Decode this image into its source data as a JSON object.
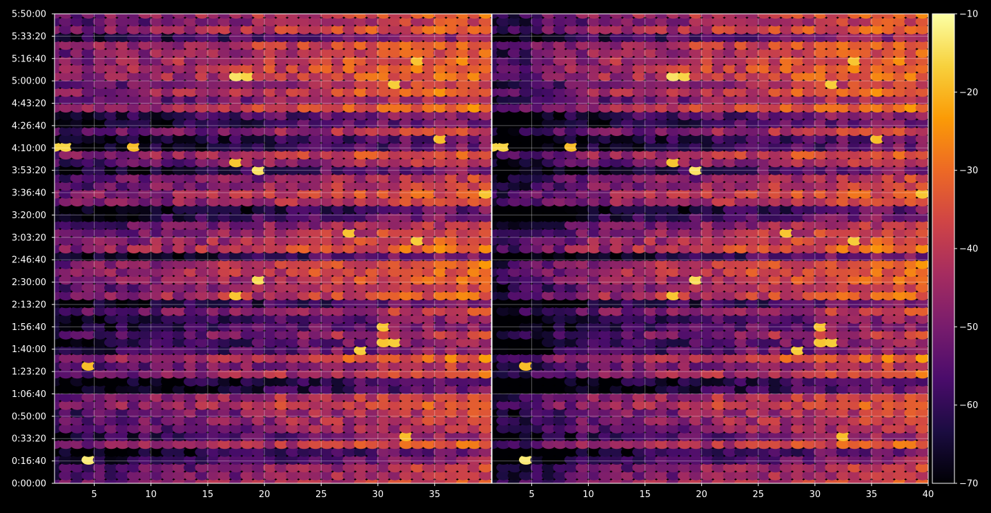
{
  "figure": {
    "background": "#000000",
    "foreground": "#ffffff"
  },
  "chart_data": {
    "type": "heatmap",
    "panels": 2,
    "title": "",
    "xlabel": "",
    "ylabel": "",
    "xlim": [
      1.5,
      40
    ],
    "ylim": [
      0,
      21000
    ],
    "x_ticks": [
      5,
      10,
      15,
      20,
      25,
      30,
      35,
      40
    ],
    "x_tick_labels": [
      "5",
      "10",
      "15",
      "20",
      "25",
      "30",
      "35",
      "40"
    ],
    "y_ticks": [
      0,
      1000,
      2000,
      3000,
      4000,
      5000,
      6000,
      7000,
      8000,
      9000,
      10000,
      11000,
      12000,
      13000,
      14000,
      15000,
      16000,
      17000,
      18000,
      19000,
      20000,
      21000
    ],
    "y_tick_labels": [
      "0:00:00",
      "0:16:40",
      "0:33:20",
      "0:50:00",
      "1:06:40",
      "1:23:20",
      "1:40:00",
      "1:56:40",
      "2:13:20",
      "2:30:00",
      "2:46:40",
      "3:03:20",
      "3:20:00",
      "3:36:40",
      "3:53:20",
      "4:10:00",
      "4:26:40",
      "4:43:20",
      "5:00:00",
      "5:16:40",
      "5:33:20",
      "5:50:00"
    ],
    "grid": true,
    "colormap": "inferno",
    "colorbar": {
      "min": -70,
      "max": -10,
      "ticks": [
        -10,
        -20,
        -30,
        -40,
        -50,
        -60,
        -70
      ],
      "tick_labels": [
        "−10",
        "−20",
        "−30",
        "−40",
        "−50",
        "−60",
        "−70"
      ],
      "stops": [
        "#000004",
        "#1b0c41",
        "#4a0c6b",
        "#781c6d",
        "#a52c60",
        "#cf4446",
        "#ed6925",
        "#fb9b06",
        "#f7d13d",
        "#fcffa4"
      ]
    },
    "columns": {
      "count": 39,
      "first": 1.5,
      "step": 1
    },
    "rows": {
      "count": 61,
      "step_seconds": 350
    },
    "value_model": {
      "base_dB": -54,
      "column_gain_dB": 0.55,
      "noise_dB": 7
    },
    "quiet_band_times": [
      "0:20:25",
      "0:35:00",
      "1:11:40",
      "1:41:40",
      "1:58:20",
      "2:15:00",
      "2:48:20",
      "3:21:40",
      "3:54:10",
      "4:12:30",
      "4:30:50",
      "5:33:20"
    ],
    "hotspots": [
      {
        "x": 17.5,
        "t": "5:00:50",
        "value_dB": -14
      },
      {
        "x": 18.5,
        "t": "5:00:50",
        "value_dB": -16
      },
      {
        "x": 19.5,
        "t": "3:55:00",
        "value_dB": -14
      },
      {
        "x": 17.5,
        "t": "3:58:20",
        "value_dB": -18
      },
      {
        "x": 4.5,
        "t": "0:20:00",
        "value_dB": -13
      },
      {
        "x": 19.5,
        "t": "2:29:10",
        "value_dB": -15
      },
      {
        "x": 17.5,
        "t": "2:22:30",
        "value_dB": -18
      },
      {
        "x": 30.5,
        "t": "1:43:20",
        "value_dB": -18
      },
      {
        "x": 31.5,
        "t": "1:43:20",
        "value_dB": -17
      },
      {
        "x": 1.5,
        "t": "4:08:20",
        "value_dB": -16
      },
      {
        "x": 2.5,
        "t": "4:08:20",
        "value_dB": -16
      },
      {
        "x": 8.5,
        "t": "4:08:20",
        "value_dB": -19
      },
      {
        "x": 33.5,
        "t": "3:03:20",
        "value_dB": -17
      },
      {
        "x": 27.5,
        "t": "3:05:00",
        "value_dB": -18
      },
      {
        "x": 28.5,
        "t": "1:36:40",
        "value_dB": -17
      },
      {
        "x": 30.5,
        "t": "1:56:40",
        "value_dB": -18
      },
      {
        "x": 31.5,
        "t": "5:00:00",
        "value_dB": -17
      },
      {
        "x": 39.5,
        "t": "3:38:20",
        "value_dB": -18
      },
      {
        "x": 35.5,
        "t": "4:15:00",
        "value_dB": -19
      },
      {
        "x": 33.5,
        "t": "5:16:40",
        "value_dB": -18
      },
      {
        "x": 32.5,
        "t": "0:35:00",
        "value_dB": -19
      },
      {
        "x": 4.5,
        "t": "1:30:00",
        "value_dB": -19
      }
    ],
    "panel_difference": "second panel darker for x < 10"
  }
}
